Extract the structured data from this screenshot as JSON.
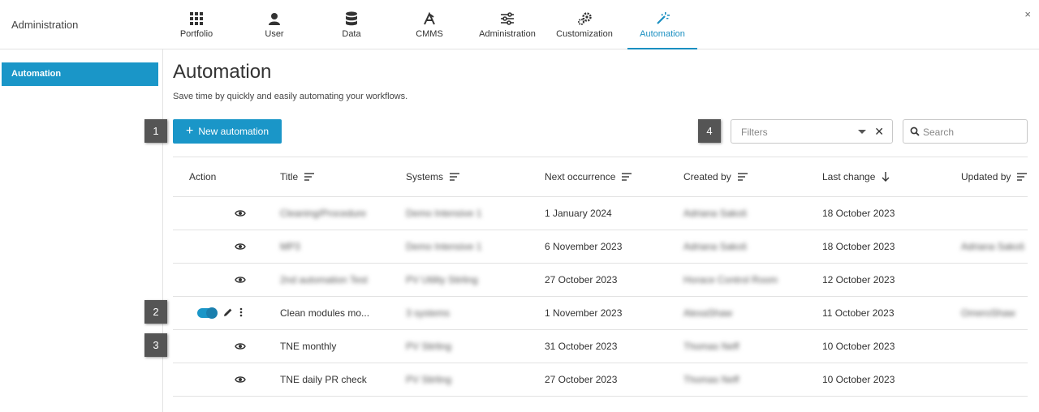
{
  "app": {
    "title": "Administration",
    "close_label": "×"
  },
  "nav": {
    "tabs": [
      {
        "label": "Portfolio",
        "icon": "grid-icon"
      },
      {
        "label": "User",
        "icon": "user-icon"
      },
      {
        "label": "Data",
        "icon": "database-icon"
      },
      {
        "label": "CMMS",
        "icon": "tools-icon"
      },
      {
        "label": "Administration",
        "icon": "sliders-icon"
      },
      {
        "label": "Customization",
        "icon": "gears-icon"
      },
      {
        "label": "Automation",
        "icon": "magic-wand-icon",
        "active": true
      }
    ]
  },
  "sidebar": {
    "items": [
      {
        "label": "Automation",
        "active": true
      }
    ]
  },
  "main": {
    "title": "Automation",
    "subtitle": "Save time by quickly and easily automating your workflows.",
    "new_button": "New automation",
    "filters_placeholder": "Filters",
    "search_placeholder": "Search"
  },
  "callouts": [
    "1",
    "2",
    "3",
    "4"
  ],
  "table": {
    "headers": {
      "action": "Action",
      "title": "Title",
      "systems": "Systems",
      "next": "Next occurrence",
      "created_by": "Created by",
      "last_change": "Last change",
      "updated_by": "Updated by"
    },
    "rows": [
      {
        "title": "Cleaning/Procedure",
        "systems": "Demo Intensive 1",
        "next": "1 January 2024",
        "created_by": "Adriana Sakoš",
        "last_change": "18 October 2023",
        "updated_by": ""
      },
      {
        "title": "MP3",
        "systems": "Demo Intensive 1",
        "next": "6 November 2023",
        "created_by": "Adriana Sakoš",
        "last_change": "18 October 2023",
        "updated_by": "Adriana Sakoš"
      },
      {
        "title": "2nd automation Test",
        "systems": "PV Utility Stirling",
        "next": "27 October 2023",
        "created_by": "Horace Control Room",
        "last_change": "12 October 2023",
        "updated_by": ""
      },
      {
        "title": "Clean modules mo...",
        "systems": "3 systems",
        "next": "1 November 2023",
        "created_by": "AlexaShaw",
        "last_change": "11 October 2023",
        "updated_by": "OmeroShaw"
      },
      {
        "title": "TNE monthly",
        "systems": "PV Stirling",
        "next": "31 October 2023",
        "created_by": "Thomas Neff",
        "last_change": "10 October 2023",
        "updated_by": ""
      },
      {
        "title": "TNE daily PR check",
        "systems": "PV Stirling",
        "next": "27 October 2023",
        "created_by": "Thomas Neff",
        "last_change": "10 October 2023",
        "updated_by": ""
      }
    ]
  }
}
